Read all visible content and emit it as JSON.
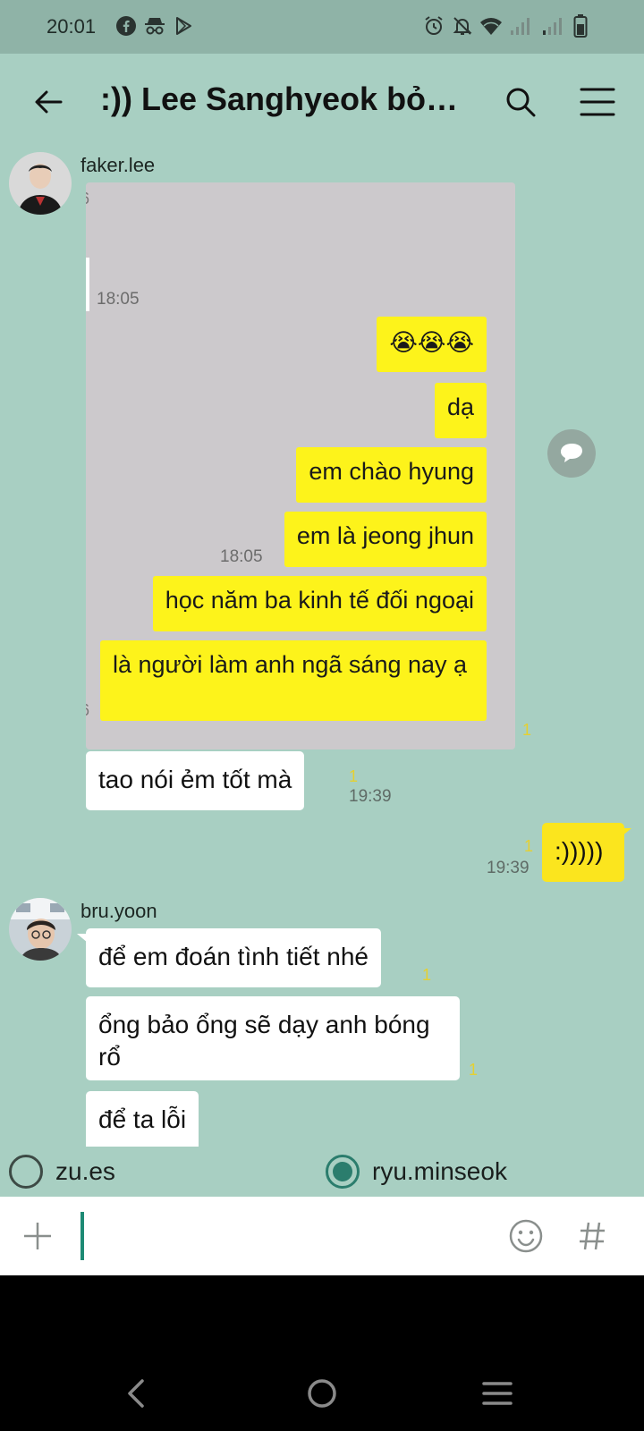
{
  "status_bar": {
    "time": "20:01",
    "icons_left": [
      "facebook-icon",
      "incognito-icon",
      "play-store-icon"
    ],
    "icons_right": [
      "alarm-icon",
      "mute-icon",
      "wifi-icon",
      "signal-icon",
      "signal-icon",
      "battery-icon"
    ]
  },
  "header": {
    "title": ":)) Lee Sanghyeok bỏ…",
    "back_icon": "arrow-left-icon",
    "search_icon": "search-icon",
    "menu_icon": "hamburger-menu-icon"
  },
  "messages": {
    "m1": {
      "sender": "faker.lee",
      "image": {
        "edge_top": "6",
        "time_top": "18:05",
        "emoji": "😭😭😭",
        "bubbles": [
          "dạ",
          "em chào hyung",
          "em là jeong jhun",
          "học năm ba kinh tế đối ngoại",
          "là người làm anh ngã sáng nay ạ"
        ],
        "time_mid": "18:05",
        "edge_bottom": "6"
      },
      "unread": "1"
    },
    "m2": {
      "text": "tao nói ẻm tốt mà",
      "unread": "1",
      "time": "19:39"
    },
    "m3": {
      "text": ":)))))",
      "unread": "1",
      "time": "19:39"
    },
    "m4": {
      "sender": "bru.yoon",
      "b1": {
        "text": "để em đoán tình tiết nhé",
        "unread": "1"
      },
      "b2": {
        "text": "ổng bảo ổng sẽ dạy anh bóng rổ",
        "unread": "1"
      },
      "b3": {
        "text": "để ta lỗi"
      }
    }
  },
  "poll": {
    "options": [
      {
        "label": "zu.es",
        "selected": false
      },
      {
        "label": "ryu.minseok",
        "selected": true
      }
    ]
  },
  "input": {
    "value": "",
    "placeholder": "",
    "plus_icon": "plus-icon",
    "emoji_icon": "smiley-icon",
    "hash_icon": "hashtag-icon"
  },
  "colors": {
    "chat_bg": "#a8cfc2",
    "my_bubble": "#fbe51e",
    "accent": "#2b7d6d",
    "unread": "#e5d030"
  }
}
